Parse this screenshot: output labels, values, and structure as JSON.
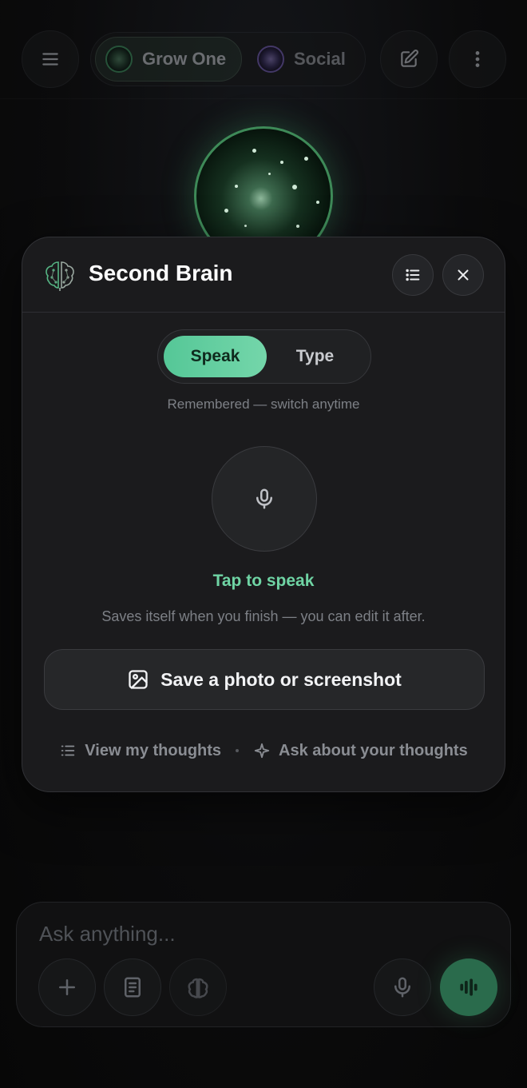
{
  "topbar": {
    "tabs": [
      {
        "label": "Grow One",
        "active": true
      },
      {
        "label": "Social",
        "active": false
      }
    ]
  },
  "modal": {
    "title": "Second Brain",
    "mode_options": [
      {
        "label": "Speak",
        "active": true
      },
      {
        "label": "Type",
        "active": false
      }
    ],
    "mode_hint": "Remembered — switch anytime",
    "tap_label": "Tap to speak",
    "saves_hint": "Saves itself when you finish — you can edit it after.",
    "photo_button": "Save a photo or screenshot",
    "links": {
      "view": "View my thoughts",
      "ask": "Ask about your thoughts"
    }
  },
  "composer": {
    "placeholder": "Ask anything..."
  },
  "colors": {
    "accent_green": "#6fd4a4",
    "speak_active": "#5fcf9e",
    "voice_button": "#2a6b4c",
    "modal_bg": "#1b1b1d"
  },
  "icons": [
    "menu-icon",
    "edit-icon",
    "more-icon",
    "brain-icon",
    "list-icon",
    "close-icon",
    "mic-icon",
    "image-icon",
    "sparkle-icon",
    "plus-icon",
    "book-icon",
    "waveform-icon"
  ]
}
